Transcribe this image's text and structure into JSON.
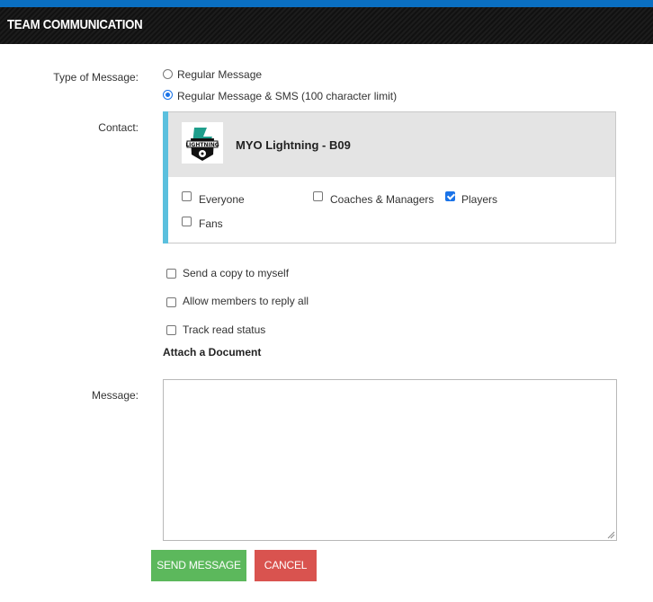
{
  "header": {
    "title": "TEAM COMMUNICATION"
  },
  "message_type": {
    "label": "Type of Message:",
    "options": [
      {
        "label": "Regular Message",
        "selected": false
      },
      {
        "label": "Regular Message & SMS (100 character limit)",
        "selected": true
      }
    ]
  },
  "contact": {
    "label": "Contact:",
    "team_name": "MYO Lightning - B09",
    "logo_text": "LIGHTNING",
    "groups": [
      {
        "label": "Everyone",
        "checked": false
      },
      {
        "label": "Coaches & Managers",
        "checked": false
      },
      {
        "label": "Players",
        "checked": true
      },
      {
        "label": "Fans",
        "checked": false
      }
    ]
  },
  "options": [
    {
      "label": "Send a copy to myself",
      "checked": false
    },
    {
      "label": "Allow members to reply all",
      "checked": false
    },
    {
      "label": "Track read status",
      "checked": false
    }
  ],
  "attach_label": "Attach a Document",
  "message": {
    "label": "Message:",
    "value": ""
  },
  "buttons": {
    "send": "SEND MESSAGE",
    "cancel": "CANCEL"
  },
  "colors": {
    "accent_blue": "#0a6fc2",
    "send_green": "#5cb85c",
    "cancel_red": "#d9534f",
    "contact_accent": "#5bc0de"
  }
}
